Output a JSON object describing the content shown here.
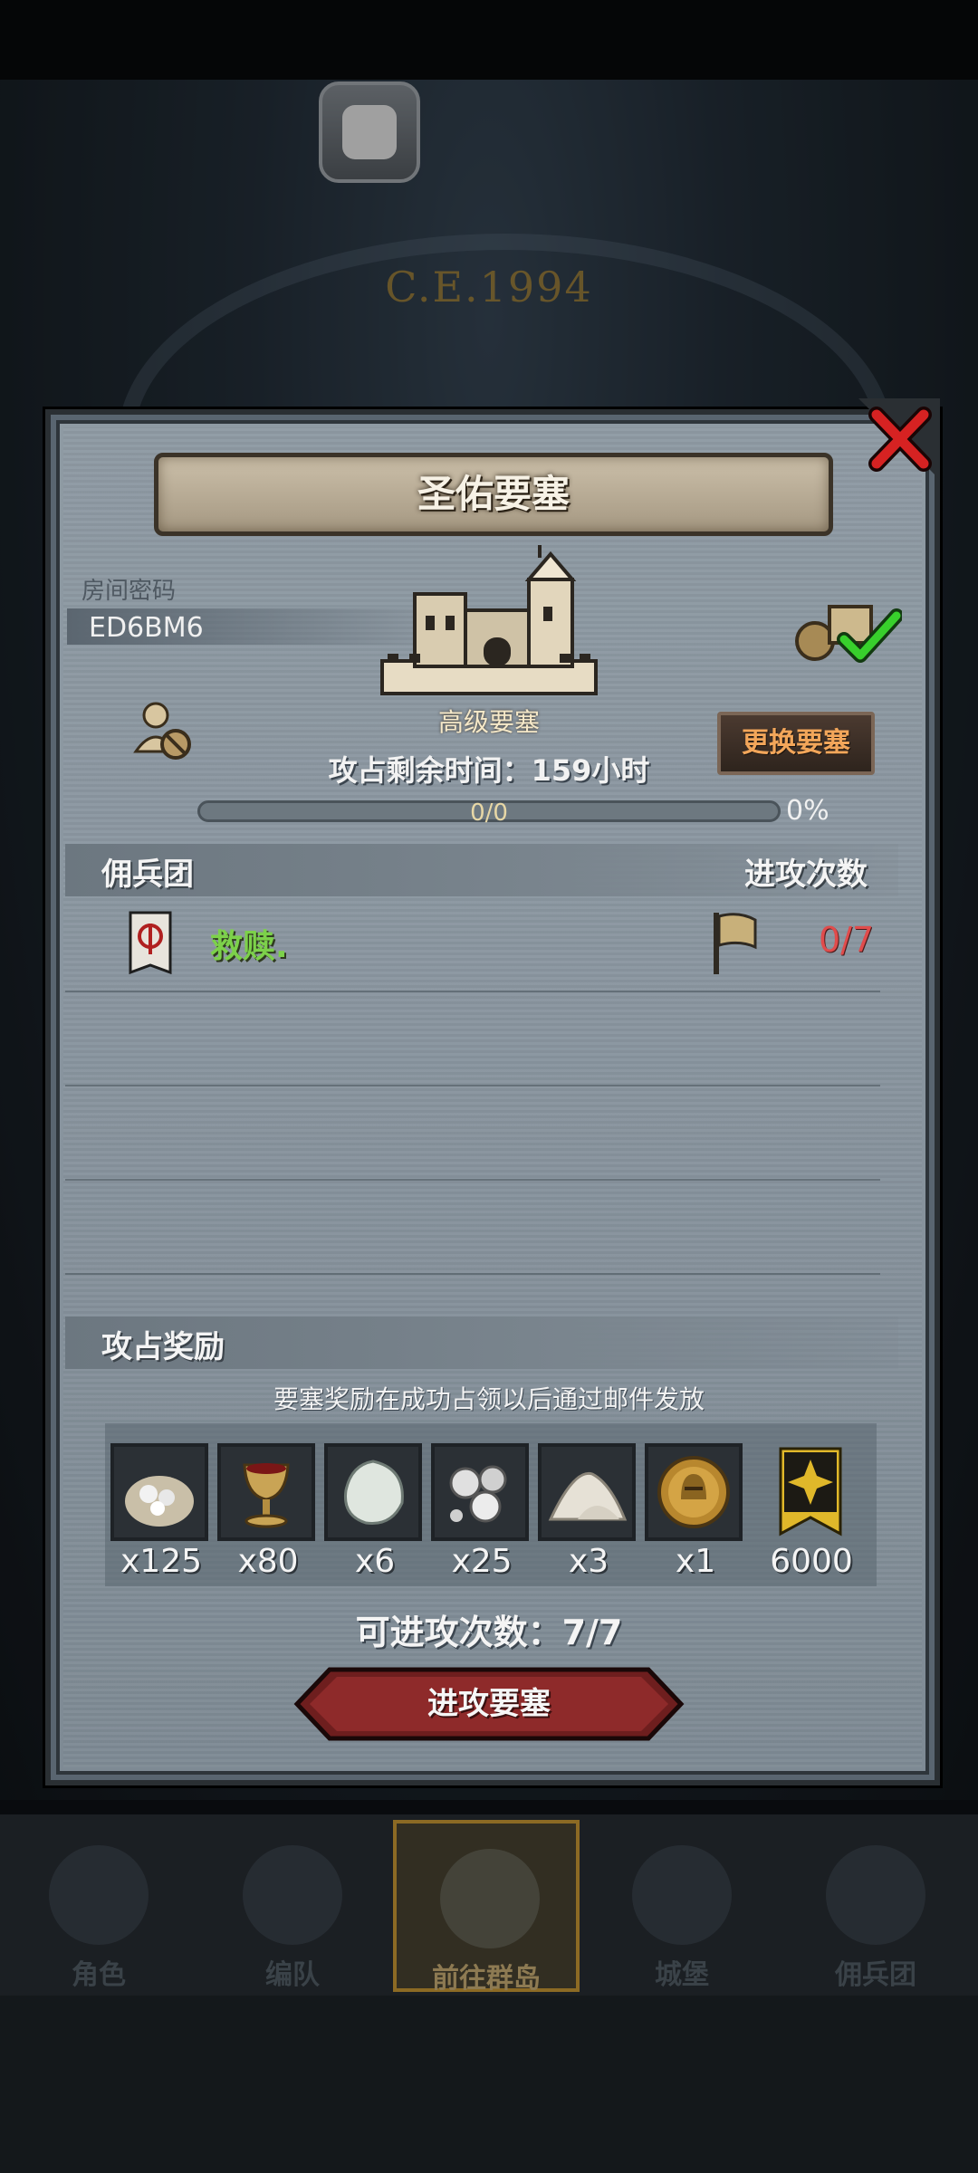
{
  "background": {
    "era_label": "C.E.1994"
  },
  "dialog": {
    "title": "圣佑要塞",
    "room_code_label": "房间密码",
    "room_code": "ED6BM6",
    "fortress_level": "高级要塞",
    "change_button": "更换要塞",
    "time_left": "攻占剩余时间：159小时",
    "progress_text": "0/0",
    "progress_percent_text": "0%",
    "progress_fraction": 0
  },
  "mercenaries": {
    "section_title": "佣兵团",
    "attacks_header": "进攻次数",
    "rows": [
      {
        "name": "救赎.",
        "attacks": "0/7"
      }
    ]
  },
  "rewards": {
    "section_title": "攻占奖励",
    "note": "要塞奖励在成功占领以后通过邮件发放",
    "items": [
      {
        "icon": "silver-ore-sack-icon",
        "qty": "x125"
      },
      {
        "icon": "goblet-icon",
        "qty": "x80"
      },
      {
        "icon": "moonstone-icon",
        "qty": "x6"
      },
      {
        "icon": "silver-nuggets-icon",
        "qty": "x25"
      },
      {
        "icon": "powder-pile-icon",
        "qty": "x3"
      },
      {
        "icon": "knight-medal-icon",
        "qty": "x1"
      },
      {
        "icon": "guild-crest-icon",
        "qty": "6000"
      }
    ]
  },
  "attacks_remaining": "可进攻次数：7/7",
  "attack_button": "进攻要塞",
  "nav": {
    "tabs": [
      {
        "label": "角色",
        "icon": "knight-icon"
      },
      {
        "label": "编队",
        "icon": "helmet-icon"
      },
      {
        "label": "前往群岛",
        "icon": "globe-icon",
        "active": true
      },
      {
        "label": "城堡",
        "icon": "castle-icon"
      },
      {
        "label": "佣兵团",
        "icon": "mercenary-icon"
      }
    ]
  }
}
